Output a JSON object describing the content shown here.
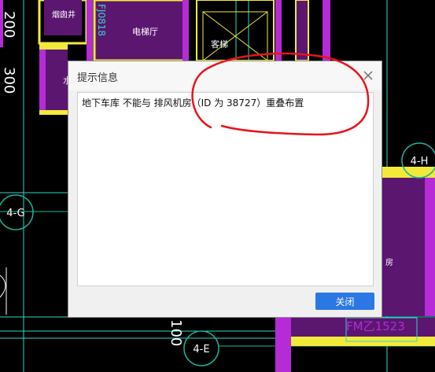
{
  "background": {
    "cad_labels": {
      "well": "烟囱井",
      "room_code": "FJ0818",
      "elevator_lobby": "电梯厅",
      "lift": "客梯",
      "partial_left": "水",
      "partial_right": "房",
      "dim_200": "200",
      "dim_300": "300",
      "dim_100": "100",
      "room_code_bottom": "FM乙1523"
    },
    "axis_bubbles": {
      "a": "4-G",
      "b": "4-H",
      "c": "4-E"
    },
    "colors": {
      "wall_purple": "#5b1670",
      "wall_magenta": "#b52bd6",
      "frame_yellow": "#f2ea3a",
      "line_cyan": "#2fd7c9",
      "bubble_green": "#18b39b",
      "annotation_red": "#e8141a"
    }
  },
  "dialog": {
    "title": "提示信息",
    "message": "地下车库 不能与 排风机房（ID 为 38727）重叠布置",
    "close_button": "关闭",
    "close_icon": "close-icon",
    "accent": "#2b78e4"
  }
}
